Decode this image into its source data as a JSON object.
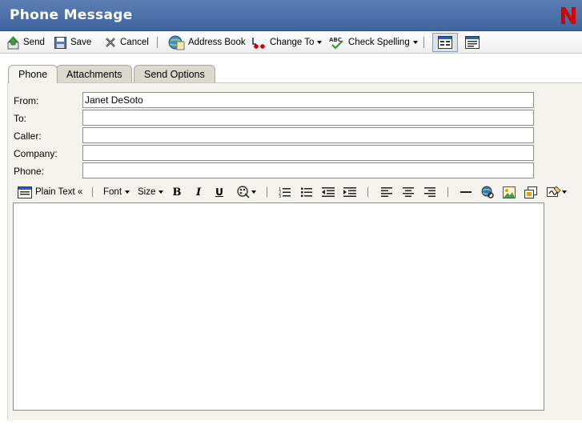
{
  "window": {
    "title": "Phone Message",
    "logo_letter": "N",
    "brand_color": "#cc0000",
    "title_bar_color": "#4a6fa8"
  },
  "toolbar": {
    "send": "Send",
    "save": "Save",
    "cancel": "Cancel",
    "address_book": "Address Book",
    "change_to": "Change To",
    "check_spelling": "Check Spelling",
    "view_icons": [
      "message-view-icon",
      "plain-view-icon"
    ]
  },
  "tabs": [
    {
      "label": "Phone",
      "active": true
    },
    {
      "label": "Attachments",
      "active": false
    },
    {
      "label": "Send Options",
      "active": false
    }
  ],
  "form": {
    "from_label": "From:",
    "from_value": "Janet DeSoto",
    "to_label": "To:",
    "to_value": "",
    "caller_label": "Caller:",
    "caller_value": "",
    "company_label": "Company:",
    "company_value": "",
    "phone_label": "Phone:",
    "phone_value": ""
  },
  "editor_toolbar": {
    "plain_text": "Plain Text «",
    "font": "Font",
    "size": "Size",
    "bold": "B",
    "italic": "I",
    "underline": "U",
    "icons": [
      "text-color-icon",
      "numbered-list-icon",
      "bullet-list-icon",
      "outdent-icon",
      "indent-icon",
      "align-left-icon",
      "align-center-icon",
      "align-right-icon",
      "horizontal-rule-icon",
      "link-icon",
      "image-icon",
      "table-icon",
      "signature-icon"
    ]
  },
  "editor": {
    "body": ""
  }
}
